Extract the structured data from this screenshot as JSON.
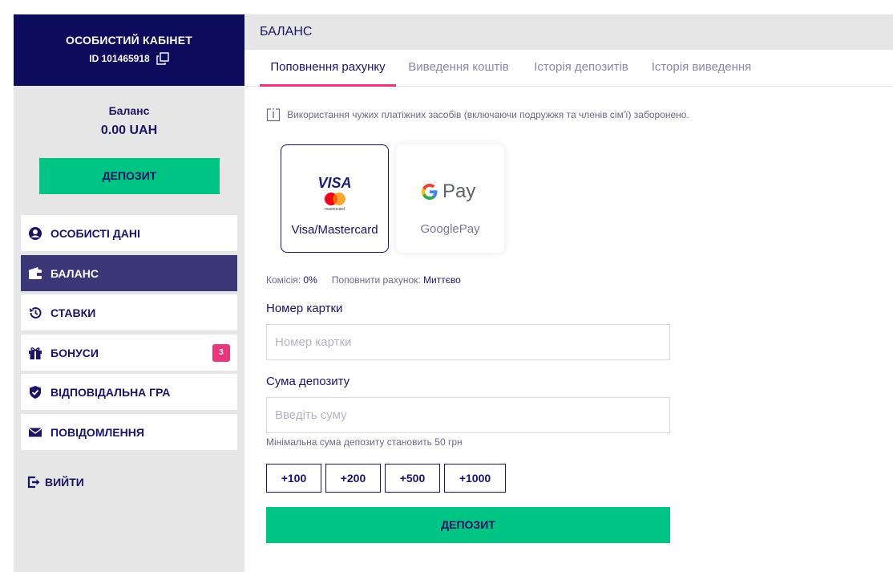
{
  "sidebar": {
    "title": "ОСОБИСТИЙ КАБІНЕТ",
    "user_id": "ID 101465918",
    "balance_label": "Баланс",
    "balance_value": "0.00 UAH",
    "deposit_label": "ДЕПОЗИТ",
    "menu": [
      {
        "label": "ОСОБИСТІ ДАНІ",
        "icon": "user-icon"
      },
      {
        "label": "БАЛАНС",
        "icon": "wallet-icon",
        "active": true
      },
      {
        "label": "СТАВКИ",
        "icon": "history-icon"
      },
      {
        "label": "БОНУСИ",
        "icon": "gift-icon",
        "badge": "3"
      },
      {
        "label": "ВІДПОВІДАЛЬНА ГРА",
        "icon": "shield-icon"
      },
      {
        "label": "ПОВІДОМЛЕННЯ",
        "icon": "envelope-icon"
      }
    ],
    "logout_label": "ВИЙТИ"
  },
  "main": {
    "title": "БАЛАНС",
    "tabs": [
      {
        "label": "Поповнення рахунку",
        "active": true
      },
      {
        "label": "Виведення коштів"
      },
      {
        "label": "Історія депозитів"
      },
      {
        "label": "Історія виведення"
      }
    ],
    "info_text": "Використання чужих платіжних засобів (включаючи подружжя та членів сім'ї) заборонено.",
    "payment_methods": [
      {
        "label": "Visa/Mastercard",
        "logo_text": "VISA",
        "logo_sub": "mastercard",
        "selected": true
      },
      {
        "label": "GooglePay",
        "logo_text": "Pay",
        "selected": false
      }
    ],
    "commission_label": "Комісія:",
    "commission_value": "0%",
    "topup_label": "Поповнити рахунок:",
    "topup_value": "Миттєво",
    "card_label": "Номер картки",
    "card_placeholder": "Номер картки",
    "amount_label": "Сума депозиту",
    "amount_placeholder": "Введіть суму",
    "min_hint": "Мінімальна сума депозиту становить 50 грн",
    "quick_amounts": [
      "+100",
      "+200",
      "+500",
      "+1000"
    ],
    "deposit_label": "ДЕПОЗИТ"
  },
  "colors": {
    "navy": "#0c0b5c",
    "active_menu": "#3b3676",
    "green": "#00c484",
    "pink": "#e8357c"
  }
}
